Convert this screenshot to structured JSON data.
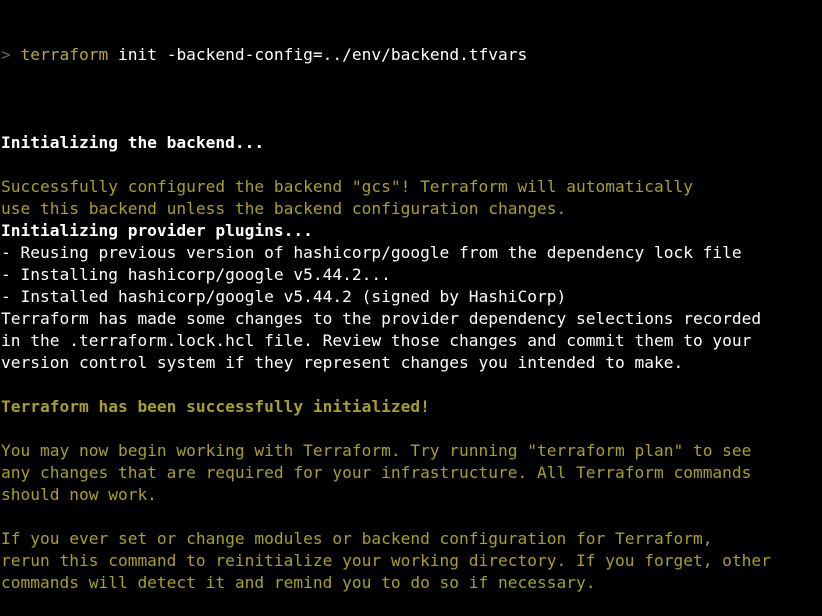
{
  "prompt": {
    "arrow": ">",
    "command": "terraform",
    "args": " init -backend-config=../env/backend.tfvars"
  },
  "output": [
    {
      "text": "",
      "style": "white"
    },
    {
      "text": "Initializing the backend...",
      "style": "white bold"
    },
    {
      "text": "",
      "style": "white"
    },
    {
      "text": "Successfully configured the backend \"gcs\"! Terraform will automatically",
      "style": "olive"
    },
    {
      "text": "use this backend unless the backend configuration changes.",
      "style": "olive"
    },
    {
      "text": "Initializing provider plugins...",
      "style": "white bold"
    },
    {
      "text": "- Reusing previous version of hashicorp/google from the dependency lock file",
      "style": "white"
    },
    {
      "text": "- Installing hashicorp/google v5.44.2...",
      "style": "white"
    },
    {
      "text": "- Installed hashicorp/google v5.44.2 (signed by HashiCorp)",
      "style": "white"
    },
    {
      "text": "Terraform has made some changes to the provider dependency selections recorded",
      "style": "white"
    },
    {
      "text": "in the .terraform.lock.hcl file. Review those changes and commit them to your",
      "style": "white"
    },
    {
      "text": "version control system if they represent changes you intended to make.",
      "style": "white"
    },
    {
      "text": "",
      "style": "white"
    },
    {
      "text": "Terraform has been successfully initialized!",
      "style": "olive bold"
    },
    {
      "text": "",
      "style": "white"
    },
    {
      "text": "You may now begin working with Terraform. Try running \"terraform plan\" to see",
      "style": "olive"
    },
    {
      "text": "any changes that are required for your infrastructure. All Terraform commands",
      "style": "olive"
    },
    {
      "text": "should now work.",
      "style": "olive"
    },
    {
      "text": "",
      "style": "white"
    },
    {
      "text": "If you ever set or change modules or backend configuration for Terraform,",
      "style": "olive"
    },
    {
      "text": "rerun this command to reinitialize your working directory. If you forget, other",
      "style": "olive"
    },
    {
      "text": "commands will detect it and remind you to do so if necessary.",
      "style": "olive"
    }
  ],
  "colors": {
    "background": "#000000",
    "text": "#ffffff",
    "success": "#a6a026",
    "prompt_arrow": "#4b6a6e",
    "command": "#b9a43c"
  }
}
